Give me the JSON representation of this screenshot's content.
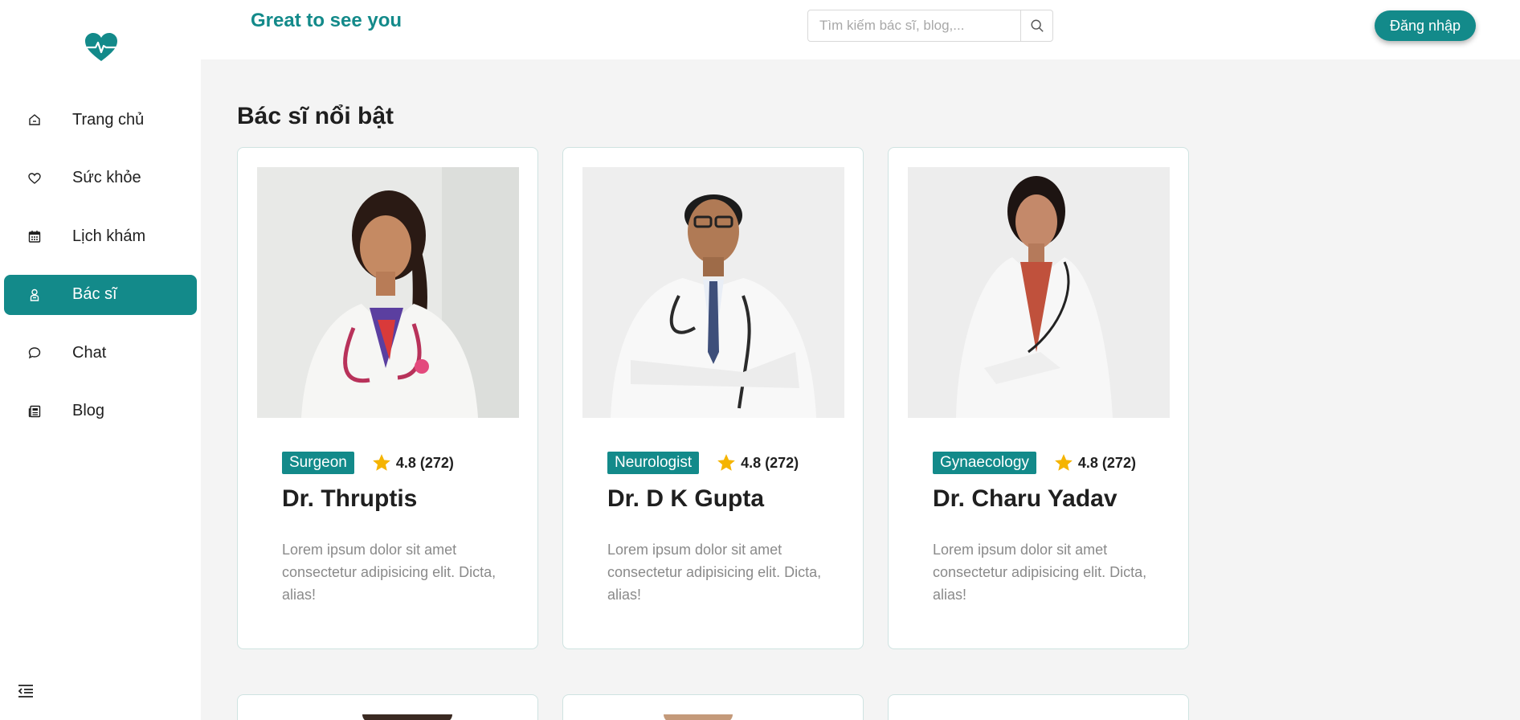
{
  "header": {
    "greeting": "Great to see you",
    "search_placeholder": "Tìm kiếm bác sĩ, blog,...",
    "login_label": "Đăng nhập"
  },
  "sidebar": {
    "items": [
      {
        "label": "Trang chủ",
        "icon": "home-icon",
        "active": false
      },
      {
        "label": "Sức khỏe",
        "icon": "heart-icon",
        "active": false
      },
      {
        "label": "Lịch khám",
        "icon": "calendar-icon",
        "active": false
      },
      {
        "label": "Bác sĩ",
        "icon": "doctor-icon",
        "active": true
      },
      {
        "label": "Chat",
        "icon": "chat-icon",
        "active": false
      },
      {
        "label": "Blog",
        "icon": "newspaper-icon",
        "active": false
      }
    ]
  },
  "main": {
    "section_title": "Bác sĩ nổi bật",
    "doctors": [
      {
        "specialty": "Surgeon",
        "rating": "4.8 (272)",
        "name": "Dr. Thruptis",
        "description": "Lorem ipsum dolor sit amet consectetur adipisicing elit. Dicta, alias!"
      },
      {
        "specialty": "Neurologist",
        "rating": "4.8 (272)",
        "name": "Dr. D K Gupta",
        "description": "Lorem ipsum dolor sit amet consectetur adipisicing elit. Dicta, alias!"
      },
      {
        "specialty": "Gynaecology",
        "rating": "4.8 (272)",
        "name": "Dr. Charu Yadav",
        "description": "Lorem ipsum dolor sit amet consectetur adipisicing elit. Dicta, alias!"
      }
    ]
  },
  "colors": {
    "accent": "#138a8a",
    "star": "#f5b400",
    "background": "#f4f4f4"
  }
}
